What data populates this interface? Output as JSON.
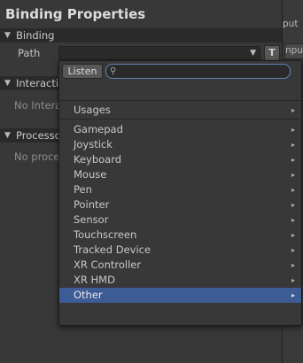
{
  "title": "Binding Properties",
  "sections": {
    "binding": "Binding",
    "interactions": "Interactions",
    "processors": "Processors"
  },
  "binding": {
    "path_label": "Path",
    "t_button": "T"
  },
  "empty": {
    "interactions": "No Interactions",
    "processors": "No processors"
  },
  "right_edge": {
    "top_text": "put",
    "box_text": "nput"
  },
  "popup": {
    "listen_label": "Listen",
    "search_value": "",
    "usages_label": "Usages",
    "items": [
      "Gamepad",
      "Joystick",
      "Keyboard",
      "Mouse",
      "Pen",
      "Pointer",
      "Sensor",
      "Touchscreen",
      "Tracked Device",
      "XR Controller",
      "XR HMD",
      "Other"
    ],
    "selected_item": "Other"
  },
  "icons": {
    "section_arrow": "triangle-down-icon",
    "search": "search-icon",
    "submenu": "chevron-right-icon",
    "dropdown": "dropdown-arrow-icon"
  },
  "colors": {
    "selection": "#3d5b94",
    "search_border": "#5f86bd"
  }
}
